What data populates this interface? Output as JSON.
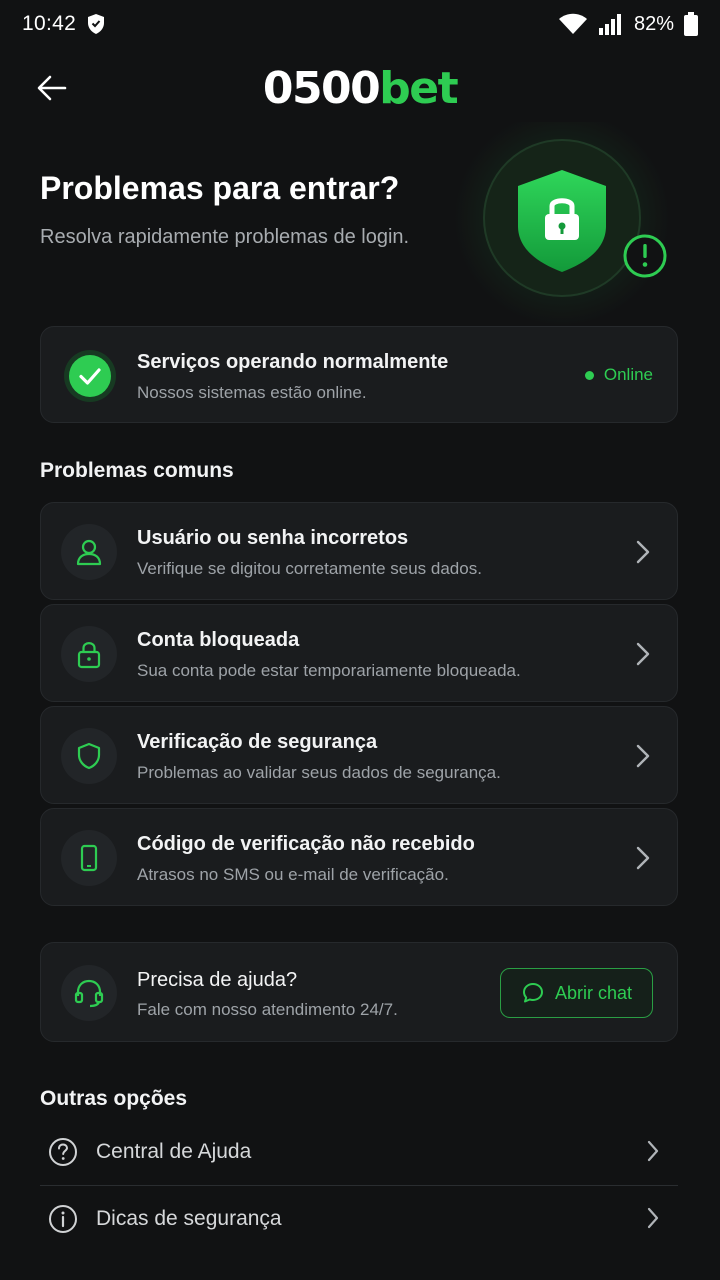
{
  "status_bar": {
    "time": "10:42",
    "battery": "82%"
  },
  "header": {
    "logo_part1": "0500",
    "logo_part2": "bet"
  },
  "hero": {
    "title": "Problemas para entrar?",
    "subtitle": "Resolva rapidamente problemas de login."
  },
  "service_status": {
    "title": "Serviços operando normalmente",
    "subtitle": "Nossos sistemas estão online.",
    "badge": "Online"
  },
  "common": {
    "heading": "Problemas comuns",
    "items": [
      {
        "title": "Usuário ou senha incorretos",
        "subtitle": "Verifique se digitou corretamente seus dados.",
        "icon": "user-icon"
      },
      {
        "title": "Conta bloqueada",
        "subtitle": "Sua conta pode estar temporariamente bloqueada.",
        "icon": "lock-icon"
      },
      {
        "title": "Verificação de segurança",
        "subtitle": "Problemas ao validar seus dados de segurança.",
        "icon": "shield-icon"
      },
      {
        "title": "Código de verificação não recebido",
        "subtitle": "Atrasos no SMS ou e-mail de verificação.",
        "icon": "phone-icon"
      }
    ]
  },
  "help": {
    "title": "Precisa de ajuda?",
    "subtitle": "Fale com nosso atendimento 24/7.",
    "button": "Abrir chat"
  },
  "other": {
    "heading": "Outras opções",
    "items": [
      {
        "label": "Central de Ajuda",
        "icon": "question-icon"
      },
      {
        "label": "Dicas de segurança",
        "icon": "info-icon"
      }
    ]
  },
  "colors": {
    "accent": "#2ecc52",
    "background": "#111213",
    "card": "#1a1c1e"
  }
}
